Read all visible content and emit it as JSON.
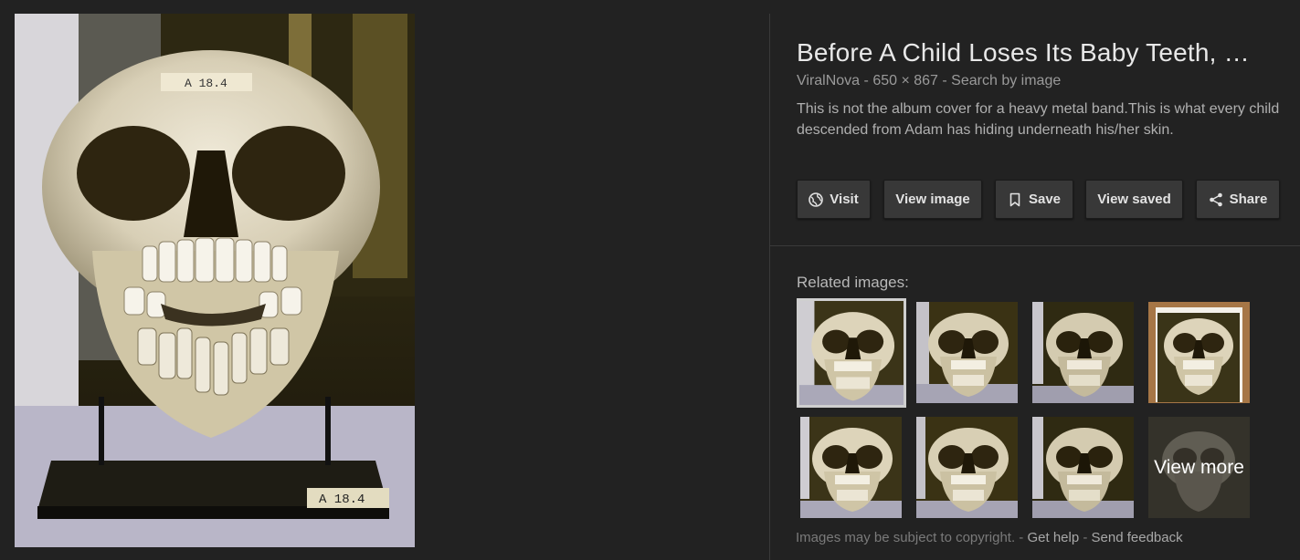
{
  "result": {
    "title": "Before A Child Loses Its Baby Teeth, …",
    "source": "ViralNova",
    "dimensions": "650 × 867",
    "search_by_image": "Search by image",
    "separator": "-",
    "description": "This is not the album cover for a heavy metal band.This is what every child descended from Adam has hiding underneath his/her skin."
  },
  "actions": {
    "visit": "Visit",
    "view_image": "View image",
    "save": "Save",
    "view_saved": "View saved",
    "share": "Share"
  },
  "related": {
    "label": "Related images:",
    "view_more": "View more"
  },
  "preview_labels": {
    "top_tag": "A 18.4",
    "base_tag": "A 18.4"
  },
  "footer": {
    "copyright": "Images may be subject to copyright.",
    "sep": "-",
    "help": "Get help",
    "feedback": "Send feedback"
  },
  "colors": {
    "background": "#222222",
    "button_bg": "#383838",
    "title": "#e8e8e8",
    "selected_outline": "#cfcfcf"
  }
}
